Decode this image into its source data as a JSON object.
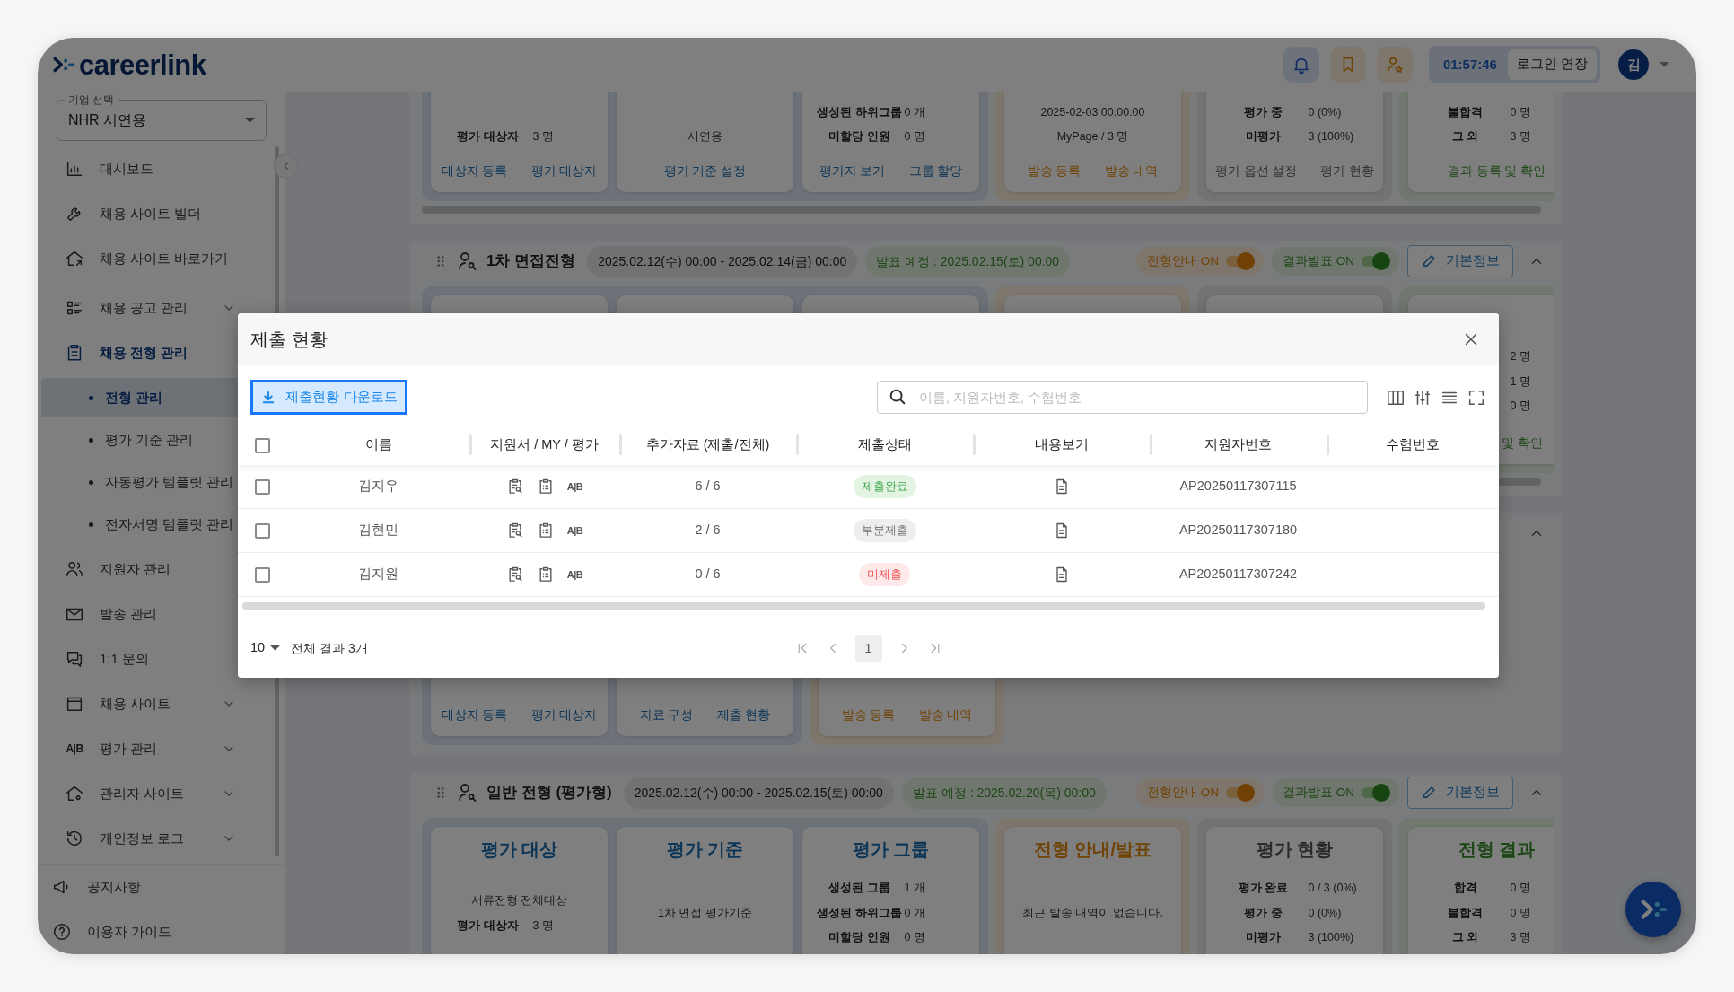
{
  "header": {
    "logo": "careerlink",
    "timer": "01:57:46",
    "extend_button": "로그인 연장",
    "avatar": "김"
  },
  "sidebar": {
    "company_select": {
      "label": "기업 선택",
      "value": "NHR 시연용"
    },
    "items": [
      {
        "label": "대시보드",
        "selected": false
      },
      {
        "label": "채용 사이트 빌더",
        "selected": false
      },
      {
        "label": "채용 사이트 바로가기",
        "selected": false
      },
      {
        "label": "채용 공고 관리",
        "selected": false,
        "expanded": false
      },
      {
        "label": "채용 전형 관리",
        "selected": true,
        "children": [
          {
            "label": "전형 관리",
            "selected": true
          },
          {
            "label": "평가 기준 관리",
            "selected": false
          },
          {
            "label": "자동평가 템플릿 관리",
            "selected": false
          },
          {
            "label": "전자서명 템플릿 관리",
            "selected": false
          }
        ]
      },
      {
        "label": "지원자 관리",
        "selected": false
      },
      {
        "label": "발송 관리",
        "selected": false
      },
      {
        "label": "1:1 문의",
        "selected": false
      },
      {
        "label": "채용 사이트",
        "selected": false,
        "expanded": false
      },
      {
        "label": "평가 관리",
        "selected": false,
        "expanded": false,
        "icon_text": "A|B"
      },
      {
        "label": "관리자 사이트",
        "selected": false,
        "expanded": false
      },
      {
        "label": "개인정보 로그",
        "selected": false,
        "expanded": false
      }
    ],
    "footer_items": [
      {
        "label": "공지사항"
      },
      {
        "label": "이용자 가이드"
      }
    ]
  },
  "stages": [
    {
      "cards": [
        {
          "kind": "target",
          "rows": [
            {
              "label": "평가 대상자",
              "value": "3 명"
            }
          ],
          "links": [
            "대상자 등록",
            "평가 대상자"
          ]
        },
        {
          "kind": "target",
          "lines": [
            "시연용"
          ],
          "links": [
            "평가 기준 설정"
          ]
        },
        {
          "kind": "target",
          "rows": [
            {
              "label": "생성된 하위그룹",
              "value": "0 개"
            },
            {
              "label": "미할당 인원",
              "value": "0 명"
            }
          ],
          "links": [
            "평가자 보기",
            "그룹 할당"
          ]
        },
        {
          "kind": "notice",
          "lines": [
            "2025-02-03 00:00:00",
            "MyPage / 3 명"
          ],
          "links": [
            "발송 등록",
            "발송 내역"
          ]
        },
        {
          "kind": "progress",
          "rows": [
            {
              "label": "평가 중",
              "value": "0 (0%)"
            },
            {
              "label": "미평가",
              "value": "3 (100%)"
            }
          ],
          "links": [
            "평가 옵션 설정",
            "평가 현황"
          ]
        },
        {
          "kind": "result",
          "rows": [
            {
              "label": "불합격",
              "value": "0 명"
            },
            {
              "label": "그 외",
              "value": "3 명"
            }
          ],
          "links": [
            "결과 등록 및 확인"
          ]
        }
      ]
    },
    {
      "title": "1차 면접전형",
      "period": "2025.02.12(수) 00:00 - 2025.02.14(금) 00:00",
      "announce": "발표 예정 : 2025.02.15(토) 00:00",
      "toggles": [
        {
          "label": "전형안내 ON",
          "on": true,
          "kind": "notice"
        },
        {
          "label": "결과발표 ON",
          "on": true,
          "kind": "result"
        }
      ],
      "info_button": "기본정보",
      "expanded": true,
      "cards": [
        {
          "kind": "target"
        },
        {
          "kind": "target"
        },
        {
          "kind": "target"
        },
        {
          "kind": "notice"
        },
        {
          "kind": "progress"
        },
        {
          "kind": "result",
          "rows": [
            {
              "value": "2 명"
            },
            {
              "value": "1 명"
            },
            {
              "value": "0 명"
            }
          ],
          "links": [
            "및 확인"
          ]
        }
      ]
    },
    {
      "expanded": true,
      "cards": [
        {
          "kind": "target",
          "links": [
            "대상자 등록",
            "평가 대상자"
          ]
        },
        {
          "kind": "target",
          "links": [
            "자료 구성",
            "제출 현황"
          ]
        },
        {
          "kind": "notice",
          "links": [
            "발송 등록",
            "발송 내역"
          ]
        }
      ]
    },
    {
      "title": "일반 전형 (평가형)",
      "period": "2025.02.12(수) 00:00 - 2025.02.15(토) 00:00",
      "announce": "발표 예정 : 2025.02.20(목) 00:00",
      "toggles": [
        {
          "label": "전형안내 ON",
          "on": true,
          "kind": "notice"
        },
        {
          "label": "결과발표 ON",
          "on": true,
          "kind": "result"
        }
      ],
      "info_button": "기본정보",
      "expanded": true,
      "cards": [
        {
          "kind": "target",
          "title": "평가 대상",
          "lines": [
            "서류전형 전체대상"
          ],
          "rows": [
            {
              "label": "평가 대상자",
              "value": "3 명"
            }
          ]
        },
        {
          "kind": "target",
          "title": "평가 기준",
          "lines": [
            "1차 면접 평가기준"
          ]
        },
        {
          "kind": "target",
          "title": "평가 그룹",
          "rows": [
            {
              "label": "생성된 그룹",
              "value": "1 개"
            },
            {
              "label": "생성된 하위그룹",
              "value": "0 개"
            },
            {
              "label": "미할당 인원",
              "value": "0 명"
            }
          ]
        },
        {
          "kind": "notice",
          "title": "전형 안내/발표",
          "lines": [
            "최근 발송 내역이 없습니다."
          ]
        },
        {
          "kind": "progress",
          "title": "평가 현황",
          "rows": [
            {
              "label": "평가 완료",
              "value": "0 / 3 (0%)"
            },
            {
              "label": "평가 중",
              "value": "0 (0%)"
            },
            {
              "label": "미평가",
              "value": "3 (100%)"
            }
          ]
        },
        {
          "kind": "result",
          "title": "전형 결과",
          "rows": [
            {
              "label": "합격",
              "value": "0 명"
            },
            {
              "label": "불합격",
              "value": "0 명"
            },
            {
              "label": "그 외",
              "value": "3 명"
            }
          ]
        }
      ]
    }
  ],
  "modal": {
    "title": "제출 현황",
    "download_button": "제출현황 다운로드",
    "search": {
      "placeholder": "이름, 지원자번호, 수험번호"
    },
    "select_all": {
      "checked": false
    },
    "columns": [
      "이름",
      "지원서 / MY / 평가",
      "추가자료 (제출/전체)",
      "제출상태",
      "내용보기",
      "지원자번호",
      "수험번호"
    ],
    "rows": [
      {
        "checked": false,
        "name": "김지우",
        "eval_mark": "A|B",
        "docs": "6 / 6",
        "status": {
          "label": "제출완료",
          "kind": "complete"
        },
        "applicant_no": "AP20250117307115"
      },
      {
        "checked": false,
        "name": "김현민",
        "eval_mark": "A|B",
        "docs": "2 / 6",
        "status": {
          "label": "부분제출",
          "kind": "partial"
        },
        "applicant_no": "AP20250117307180"
      },
      {
        "checked": false,
        "name": "김지원",
        "eval_mark": "A|B",
        "docs": "0 / 6",
        "status": {
          "label": "미제출",
          "kind": "missing"
        },
        "applicant_no": "AP20250117307242"
      }
    ],
    "page_size": "10",
    "total": "전체 결과 3개",
    "pages": [
      {
        "label": "1",
        "selected": true
      }
    ]
  }
}
